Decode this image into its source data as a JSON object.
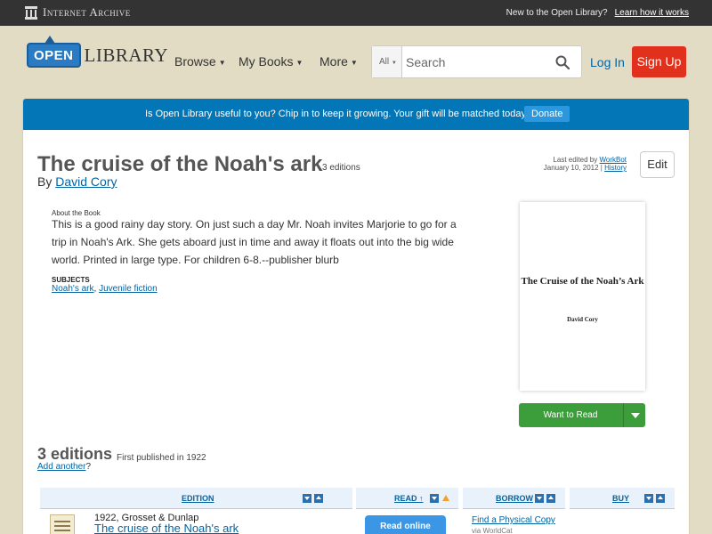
{
  "topbar": {
    "ia_logo_text": "Internet Archive",
    "new_text": "New to the Open Library?",
    "learn_link": "Learn how it works"
  },
  "header": {
    "logo_open": "OPEN",
    "logo_library": "LIBRARY",
    "nav": [
      {
        "label": "Browse"
      },
      {
        "label": "My Books"
      },
      {
        "label": "More"
      }
    ],
    "search_scope": "All",
    "search_placeholder": "Search",
    "login": "Log In",
    "signup": "Sign Up"
  },
  "donate": {
    "message": "Is Open Library useful to you? Chip in to keep it growing. Your gift will be matched today!",
    "button": "Donate"
  },
  "book": {
    "title": "The cruise of the Noah's ark",
    "editions_count": "3 editions",
    "by": "By",
    "author": "David Cory",
    "last_edited_prefix": "Last edited by",
    "last_edited_user": "WorkBot",
    "last_edited_date": "January 10, 2012",
    "history": "History",
    "edit": "Edit",
    "about_label": "About the Book",
    "description": "This is a good rainy day story. On just such a day Mr. Noah invites Marjorie to go for a trip in Noah's Ark. She gets aboard just in time and away it floats out into the big wide world. Printed in large type. For children 6-8.--publisher blurb",
    "subjects_label": "SUBJECTS",
    "subjects": [
      "Noah's ark",
      "Juvenile fiction"
    ],
    "cover_title": "The Cruise of the Noah’s Ark",
    "cover_author": "David Cory",
    "want_to_read": "Want to Read"
  },
  "editions": {
    "heading": "3 editions",
    "first_published": "First published in 1922",
    "add_another": "Add another",
    "columns": {
      "edition": "EDITION",
      "read": "READ ↑",
      "borrow": "BORROW",
      "buy": "BUY"
    },
    "rows": [
      {
        "publisher": "1922, Grosset & Dunlap",
        "title": "The cruise of the Noah's ark",
        "read_button": "Read online",
        "borrow_link": "Find a Physical Copy",
        "borrow_via": "via WorldCat"
      }
    ]
  },
  "colors": {
    "topbar": "#333333",
    "page_bg": "#e2dcc5",
    "donate_bar": "#0376b8",
    "signup": "#e1301c",
    "want_to_read": "#3b9e3b",
    "link": "#0263a3"
  }
}
